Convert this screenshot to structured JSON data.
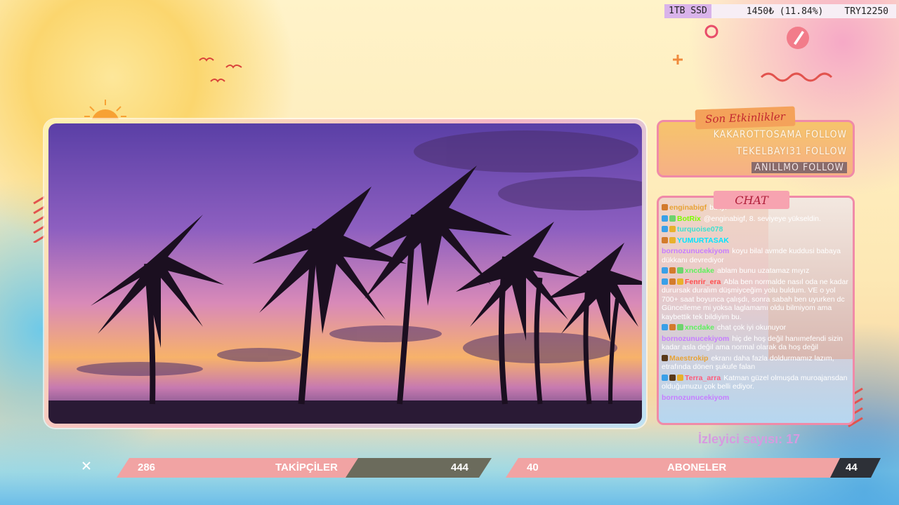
{
  "statusbar": {
    "storage": "1TB SSD",
    "price": "1450₺ (11.84%)",
    "goal": "TRY12250"
  },
  "events": {
    "title": "Son Etkinlikler",
    "items": [
      {
        "text": "KAKAROTTOSAMA FOLLOW"
      },
      {
        "text": "TEKELBAYI31 FOLLOW"
      },
      {
        "text": "ANILLMO FOLLOW"
      }
    ]
  },
  "chat": {
    "title": "CHAT",
    "messages": [
      {
        "user": "enginabigf",
        "text": "bu iyi",
        "color": "#e8a335"
      },
      {
        "user": "BotRix",
        "text": "@enginabigf, 8. seviyeye yükseldin.",
        "color": "#7CFC00"
      },
      {
        "user": "turquoise078",
        "text": "",
        "color": "#40e0d0"
      },
      {
        "user": "YUMURTASAK",
        "text": "",
        "color": "#00e5ff"
      },
      {
        "user": "bornozunucekiyom",
        "text": "koyu bilal avmde kuddusi babaya dükkanı devrediyor",
        "color": "#c77dff"
      },
      {
        "user": "xncdake",
        "text": "ablam bunu uzatamaz mıyız",
        "color": "#5df25d"
      },
      {
        "user": "Fenrir_era",
        "text": "Abla ben normalde nasıl oda ne kadar durursak duralım düşmiyceğim yolu buldum. VE o yol 700+ saat boyunca çalışdı, sonra sabah ben uyurken dc Güncelleme mi yoksa laglamamı oldu bilmiyom ama kaybettik tek bildiyim bu.",
        "color": "#ff4d4d"
      },
      {
        "user": "xncdake",
        "text": "chat çok iyi okunuyor",
        "color": "#5df25d"
      },
      {
        "user": "bornozunucekiyom",
        "text": "hiç de hoş değil hanımefendi sizin kadar asla değil ama normal olarak da hoş değil",
        "color": "#c77dff"
      },
      {
        "user": "Maestrokip",
        "text": "ekranı daha fazla doldurmamız lazım, etrafında dönen şukufe falan",
        "color": "#e8a335"
      },
      {
        "user": "Terra_arra",
        "text": "Katman güzel olmuşda muroajansdan olduğumuzu çok belli ediyor.",
        "color": "#ff5a7a"
      },
      {
        "user": "bornozunucekiyom",
        "text": "",
        "color": "#c77dff"
      }
    ]
  },
  "viewers": "İzleyici sayısı: 17",
  "followers_bar": {
    "current": "286",
    "label": "TAKİPÇİLER",
    "goal": "444",
    "progress": 0.64
  },
  "subs_bar": {
    "current": "40",
    "label": "ABONELER",
    "goal": "44",
    "progress": 0.91
  },
  "colors": {
    "accent_pink": "#f08aa8",
    "bar_pink": "#f1a3a3",
    "viewer_text": "#d69be0"
  },
  "icons": [
    "brush-logo-icon",
    "close-icon",
    "sun-icon",
    "bird-icon"
  ]
}
